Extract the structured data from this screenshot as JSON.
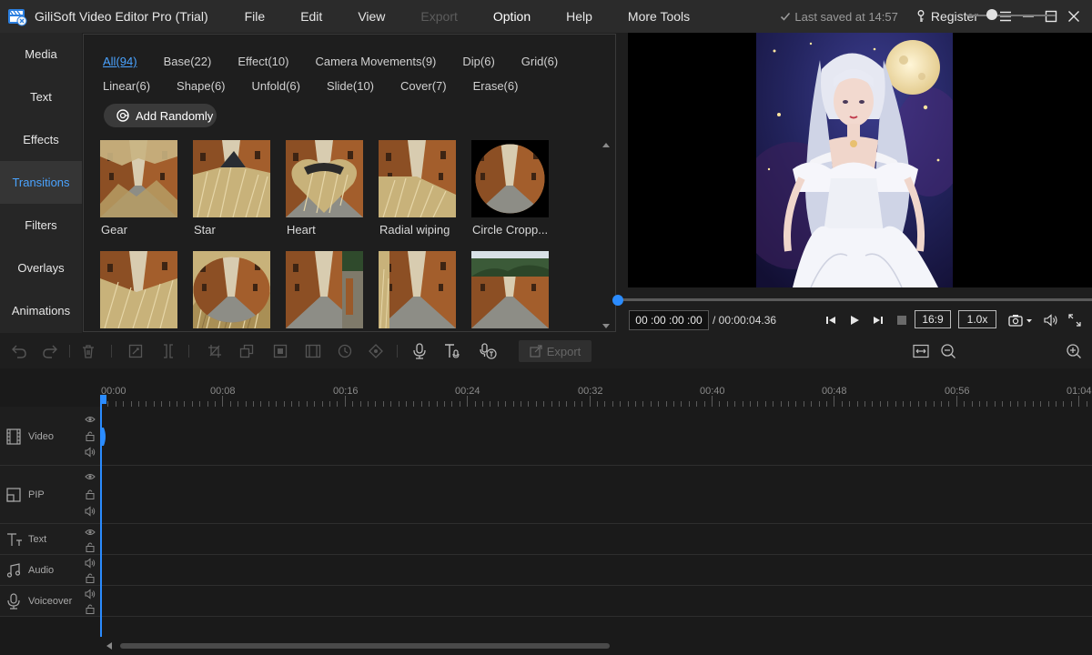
{
  "app": {
    "title": "GiliSoft Video Editor Pro (Trial)",
    "menu": [
      {
        "label": "File",
        "disabled": false
      },
      {
        "label": "Edit",
        "disabled": false
      },
      {
        "label": "View",
        "disabled": false
      },
      {
        "label": "Export",
        "disabled": true
      },
      {
        "label": "Option",
        "disabled": false
      },
      {
        "label": "Help",
        "disabled": false
      },
      {
        "label": "More Tools",
        "disabled": false
      }
    ],
    "saved_text": "Last saved at 14:57",
    "register_label": "Register"
  },
  "sidebar": {
    "items": [
      {
        "label": "Media",
        "active": false
      },
      {
        "label": "Text",
        "active": false
      },
      {
        "label": "Effects",
        "active": false
      },
      {
        "label": "Transitions",
        "active": true
      },
      {
        "label": "Filters",
        "active": false
      },
      {
        "label": "Overlays",
        "active": false
      },
      {
        "label": "Animations",
        "active": false
      }
    ]
  },
  "library": {
    "categories_row1": [
      "All(94)",
      "Base(22)",
      "Effect(10)",
      "Camera Movements(9)",
      "Dip(6)",
      "Grid(6)"
    ],
    "categories_row2": [
      "Linear(6)",
      "Shape(6)",
      "Unfold(6)",
      "Slide(10)",
      "Cover(7)",
      "Erase(6)"
    ],
    "active_category": "All(94)",
    "add_randomly_label": "Add Randomly",
    "transitions": [
      {
        "label": "Gear",
        "icon": "gear-transition"
      },
      {
        "label": "Star",
        "icon": "star-transition"
      },
      {
        "label": "Heart",
        "icon": "heart-transition"
      },
      {
        "label": "Radial wiping",
        "icon": "radial-wipe-transition"
      },
      {
        "label": "Circle Cropp...",
        "icon": "circle-crop-transition"
      },
      {
        "label": "",
        "icon": "split-transition"
      },
      {
        "label": "",
        "icon": "oval-transition"
      },
      {
        "label": "",
        "icon": "slide-right-transition"
      },
      {
        "label": "",
        "icon": "slide-split-transition"
      },
      {
        "label": "",
        "icon": "cover-transition"
      }
    ]
  },
  "player": {
    "current_time": "00 :00 :00 :00",
    "total_time": "/ 00:00:04.36",
    "aspect_ratio": "16:9",
    "speed": "1.0x",
    "progress": 0
  },
  "toolbar": {
    "export_label": "Export",
    "zoom_level": 0.28
  },
  "timeline": {
    "ruler_labels": [
      "00:00",
      "00:08",
      "00:16",
      "00:24",
      "00:32",
      "00:40",
      "00:48",
      "00:56",
      "01:04"
    ],
    "tracks": [
      {
        "name": "Video",
        "icon": "film-icon"
      },
      {
        "name": "PIP",
        "icon": "pip-icon"
      },
      {
        "name": "Text",
        "icon": "text-icon"
      },
      {
        "name": "Audio",
        "icon": "music-icon"
      },
      {
        "name": "Voiceover",
        "icon": "mic-icon"
      }
    ]
  },
  "colors": {
    "accent": "#2b8cff",
    "active_text": "#4aa3ff",
    "background": "#1e1e1e"
  }
}
